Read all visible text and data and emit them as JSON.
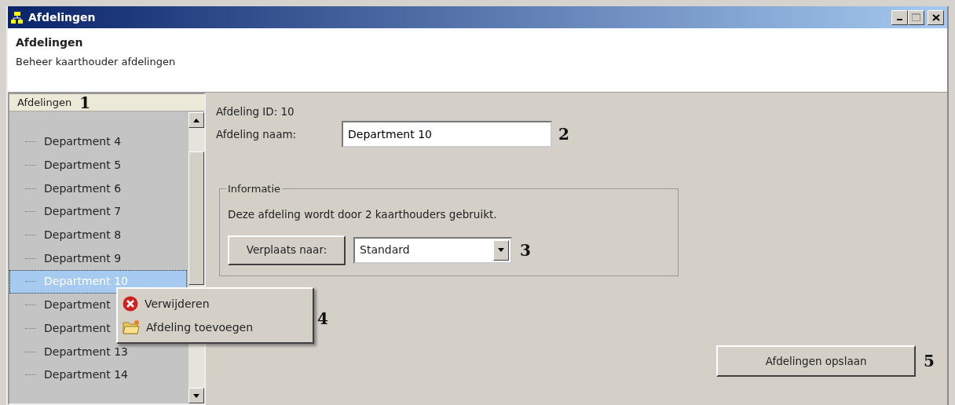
{
  "window": {
    "title": "Afdelingen"
  },
  "header": {
    "title": "Afdelingen",
    "subtitle": "Beheer kaarthouder afdelingen"
  },
  "tree": {
    "heading": "Afdelingen",
    "annotation": "1",
    "items": [
      {
        "label": "Department 4",
        "selected": false
      },
      {
        "label": "Department 5",
        "selected": false
      },
      {
        "label": "Department 6",
        "selected": false
      },
      {
        "label": "Department 7",
        "selected": false
      },
      {
        "label": "Department 8",
        "selected": false
      },
      {
        "label": "Department 9",
        "selected": false
      },
      {
        "label": "Department 10",
        "selected": true
      },
      {
        "label": "Department",
        "selected": false
      },
      {
        "label": "Department",
        "selected": false
      },
      {
        "label": "Department 13",
        "selected": false
      },
      {
        "label": "Department 14",
        "selected": false
      }
    ]
  },
  "context_menu": {
    "annotation": "4",
    "items": [
      {
        "kind": "delete",
        "label": "Verwijderen"
      },
      {
        "kind": "add",
        "label": "Afdeling toevoegen"
      }
    ]
  },
  "detail": {
    "id_label": "Afdeling ID: 10",
    "name_label": "Afdeling naam:",
    "name_value": "Department 10",
    "name_annotation": "2",
    "group": {
      "title": "Informatie",
      "text": "Deze afdeling wordt door 2 kaarthouders gebruikt.",
      "move_button": "Verplaats naar:",
      "target": "Standard",
      "annotation": "3"
    },
    "save_button": "Afdelingen opslaan",
    "save_annotation": "5"
  }
}
